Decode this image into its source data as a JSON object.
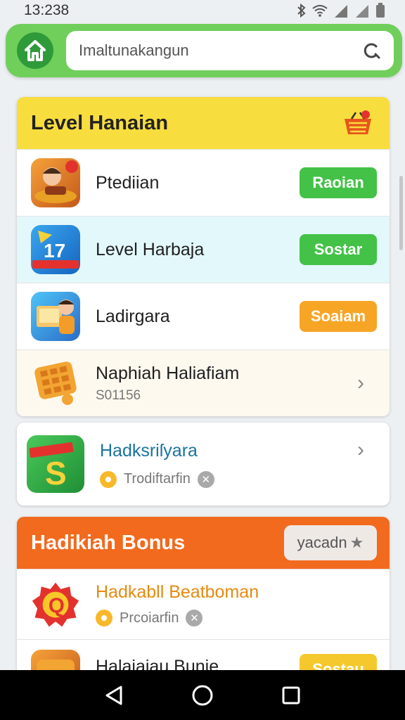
{
  "status_bar": {
    "time": "13:238"
  },
  "search": {
    "placeholder": "Imaltunakangun",
    "value": "Imaltunakangun"
  },
  "section1": {
    "title": "Level Hanaian",
    "items": [
      {
        "title": "Ptediian",
        "button": "Raoian"
      },
      {
        "title": "Level Harbaja",
        "button": "Sostar"
      },
      {
        "title": "Ladirgara",
        "button": "Soaiam"
      },
      {
        "title": "Naphiah Haliafiam",
        "subtitle": "S01156"
      }
    ]
  },
  "section2": {
    "title": "Hadksriſyara",
    "meta": "Trodiftarfin"
  },
  "section3": {
    "title": "Hadikiah Bonus",
    "header_button": "yacadn",
    "items": [
      {
        "title": "Hadkabll Beatboman",
        "meta": "Prcoiarfin"
      },
      {
        "title": "Halaiaiau Bunie",
        "button": "Sostau"
      }
    ]
  },
  "colors": {
    "header_green": "#6fcf5a",
    "section_yellow": "#f8dd3e",
    "section_orange": "#f26a1e",
    "pill_green": "#43c247",
    "pill_orange": "#f7a525"
  }
}
